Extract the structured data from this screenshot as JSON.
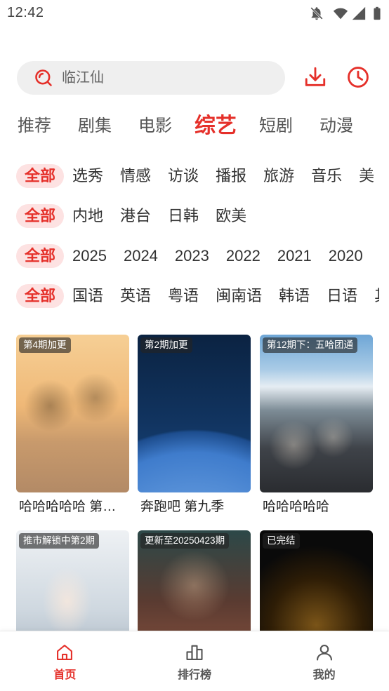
{
  "status_bar": {
    "time": "12:42",
    "icons": [
      "notifications-off-icon",
      "wifi-icon",
      "signal-icon",
      "battery-icon"
    ]
  },
  "search": {
    "value": "临江仙",
    "icon": "search-icon"
  },
  "header_actions": [
    {
      "icon": "download-icon"
    },
    {
      "icon": "history-icon"
    }
  ],
  "category_tabs": {
    "active_index": 3,
    "items": [
      {
        "label": "推荐"
      },
      {
        "label": "剧集"
      },
      {
        "label": "电影"
      },
      {
        "label": "综艺"
      },
      {
        "label": "短剧"
      },
      {
        "label": "动漫"
      }
    ]
  },
  "filters": [
    {
      "selected_index": 0,
      "items": [
        "全部",
        "选秀",
        "情感",
        "访谈",
        "播报",
        "旅游",
        "音乐",
        "美"
      ]
    },
    {
      "selected_index": 0,
      "items": [
        "全部",
        "内地",
        "港台",
        "日韩",
        "欧美"
      ]
    },
    {
      "selected_index": 0,
      "items": [
        "全部",
        "2025",
        "2024",
        "2023",
        "2022",
        "2021",
        "2020"
      ]
    },
    {
      "selected_index": 0,
      "items": [
        "全部",
        "国语",
        "英语",
        "粤语",
        "闽南语",
        "韩语",
        "日语",
        "其"
      ]
    }
  ],
  "cards": [
    {
      "badge": "第4期加更",
      "title": "哈哈哈哈哈 第…"
    },
    {
      "badge": "第2期加更",
      "title": "奔跑吧 第九季"
    },
    {
      "badge": "第12期下：五哈团通",
      "title": "哈哈哈哈哈"
    },
    {
      "badge": "推市解锁中第2期"
    },
    {
      "badge": "更新至20250423期"
    },
    {
      "badge": "已完结"
    }
  ],
  "bottom_nav": {
    "active_index": 0,
    "items": [
      {
        "label": "首页",
        "icon": "home-icon"
      },
      {
        "label": "排行榜",
        "icon": "ranking-icon"
      },
      {
        "label": "我的",
        "icon": "profile-icon"
      }
    ]
  },
  "colors": {
    "accent": "#e5302a",
    "chip_active_bg": "#fde2e2",
    "search_bg": "#efefef",
    "text_primary": "#222222",
    "text_secondary": "#555555"
  }
}
